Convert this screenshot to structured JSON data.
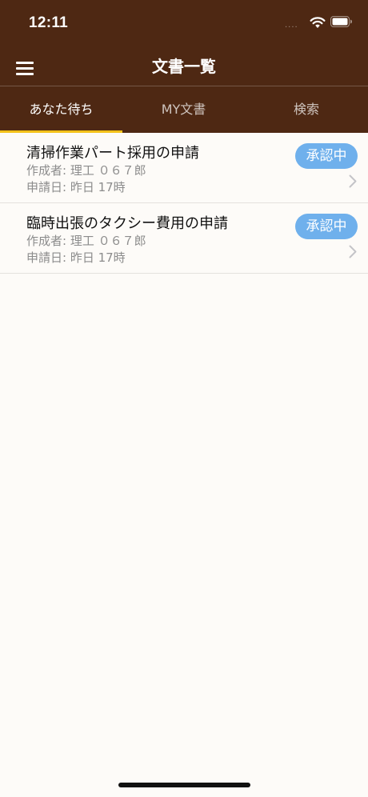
{
  "status_bar": {
    "time": "12:11",
    "signal_dots": "....",
    "wifi_icon": "wifi-icon",
    "battery_icon": "battery-icon"
  },
  "header": {
    "title": "文書一覧",
    "menu_icon": "hamburger-menu-icon",
    "background_color": "#4e2813"
  },
  "tabs": [
    {
      "label": "あなた待ち",
      "active": true
    },
    {
      "label": "MY文書",
      "active": false
    },
    {
      "label": "検索",
      "active": false
    }
  ],
  "tab_indicator_color": "#f3c21a",
  "documents": [
    {
      "title": "清掃作業パート採用の申請",
      "author": "作成者: 理工 ０６７郎",
      "date": "申請日: 昨日 17時",
      "status": "承認中"
    },
    {
      "title": "臨時出張のタクシー費用の申請",
      "author": "作成者: 理工 ０６７郎",
      "date": "申請日: 昨日 17時",
      "status": "承認中"
    }
  ],
  "status_badge_color": "#6fb0ec"
}
